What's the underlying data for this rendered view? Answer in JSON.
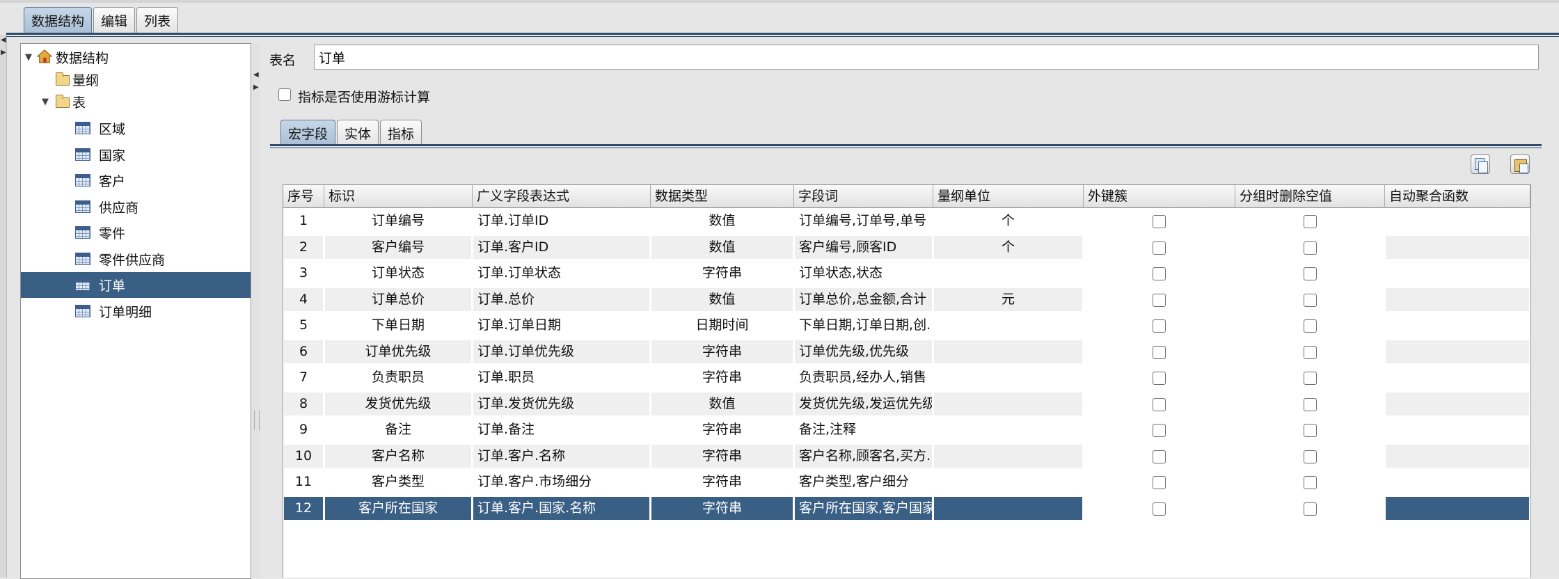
{
  "top_tabs": [
    {
      "label": "数据结构",
      "active": true
    },
    {
      "label": "编辑",
      "active": false
    },
    {
      "label": "列表",
      "active": false
    }
  ],
  "tree": {
    "root": "数据结构",
    "measure": "量纲",
    "tables_group": "表",
    "tables": [
      "区域",
      "国家",
      "客户",
      "供应商",
      "零件",
      "零件供应商",
      "订单",
      "订单明细"
    ],
    "selected": "订单"
  },
  "form": {
    "table_name_label": "表名",
    "table_name_value": "订单",
    "cursor_calc_label": "指标是否使用游标计算",
    "cursor_calc_checked": false
  },
  "sub_tabs": [
    {
      "label": "宏字段",
      "active": true
    },
    {
      "label": "实体",
      "active": false
    },
    {
      "label": "指标",
      "active": false
    }
  ],
  "toolbar": {
    "copy_icon": "copy-icon",
    "paste_icon": "paste-icon"
  },
  "grid": {
    "columns": [
      "序号",
      "标识",
      "广义字段表达式",
      "数据类型",
      "字段词",
      "量纲单位",
      "外键簇",
      "分组时删除空值",
      "自动聚合函数"
    ],
    "rows": [
      {
        "no": "1",
        "id": "订单编号",
        "expr": "订单.订单ID",
        "type": "数值",
        "words": "订单编号,订单号,单号",
        "unit": "个"
      },
      {
        "no": "2",
        "id": "客户编号",
        "expr": "订单.客户ID",
        "type": "数值",
        "words": "客户编号,顾客ID",
        "unit": "个"
      },
      {
        "no": "3",
        "id": "订单状态",
        "expr": "订单.订单状态",
        "type": "字符串",
        "words": "订单状态,状态",
        "unit": ""
      },
      {
        "no": "4",
        "id": "订单总价",
        "expr": "订单.总价",
        "type": "数值",
        "words": "订单总价,总金额,合计",
        "unit": "元"
      },
      {
        "no": "5",
        "id": "下单日期",
        "expr": "订单.订单日期",
        "type": "日期时间",
        "words": "下单日期,订单日期,创...",
        "unit": ""
      },
      {
        "no": "6",
        "id": "订单优先级",
        "expr": "订单.订单优先级",
        "type": "字符串",
        "words": "订单优先级,优先级",
        "unit": ""
      },
      {
        "no": "7",
        "id": "负责职员",
        "expr": "订单.职员",
        "type": "字符串",
        "words": "负责职员,经办人,销售",
        "unit": ""
      },
      {
        "no": "8",
        "id": "发货优先级",
        "expr": "订单.发货优先级",
        "type": "数值",
        "words": "发货优先级,发运优先级",
        "unit": ""
      },
      {
        "no": "9",
        "id": "备注",
        "expr": "订单.备注",
        "type": "字符串",
        "words": "备注,注释",
        "unit": ""
      },
      {
        "no": "10",
        "id": "客户名称",
        "expr": "订单.客户.名称",
        "type": "字符串",
        "words": "客户名称,顾客名,买方...",
        "unit": ""
      },
      {
        "no": "11",
        "id": "客户类型",
        "expr": "订单.客户.市场细分",
        "type": "字符串",
        "words": "客户类型,客户细分",
        "unit": ""
      },
      {
        "no": "12",
        "id": "客户所在国家",
        "expr": "订单.客户.国家.名称",
        "type": "字符串",
        "words": "客户所在国家,客户国家",
        "unit": ""
      }
    ],
    "selected_row": "12"
  }
}
